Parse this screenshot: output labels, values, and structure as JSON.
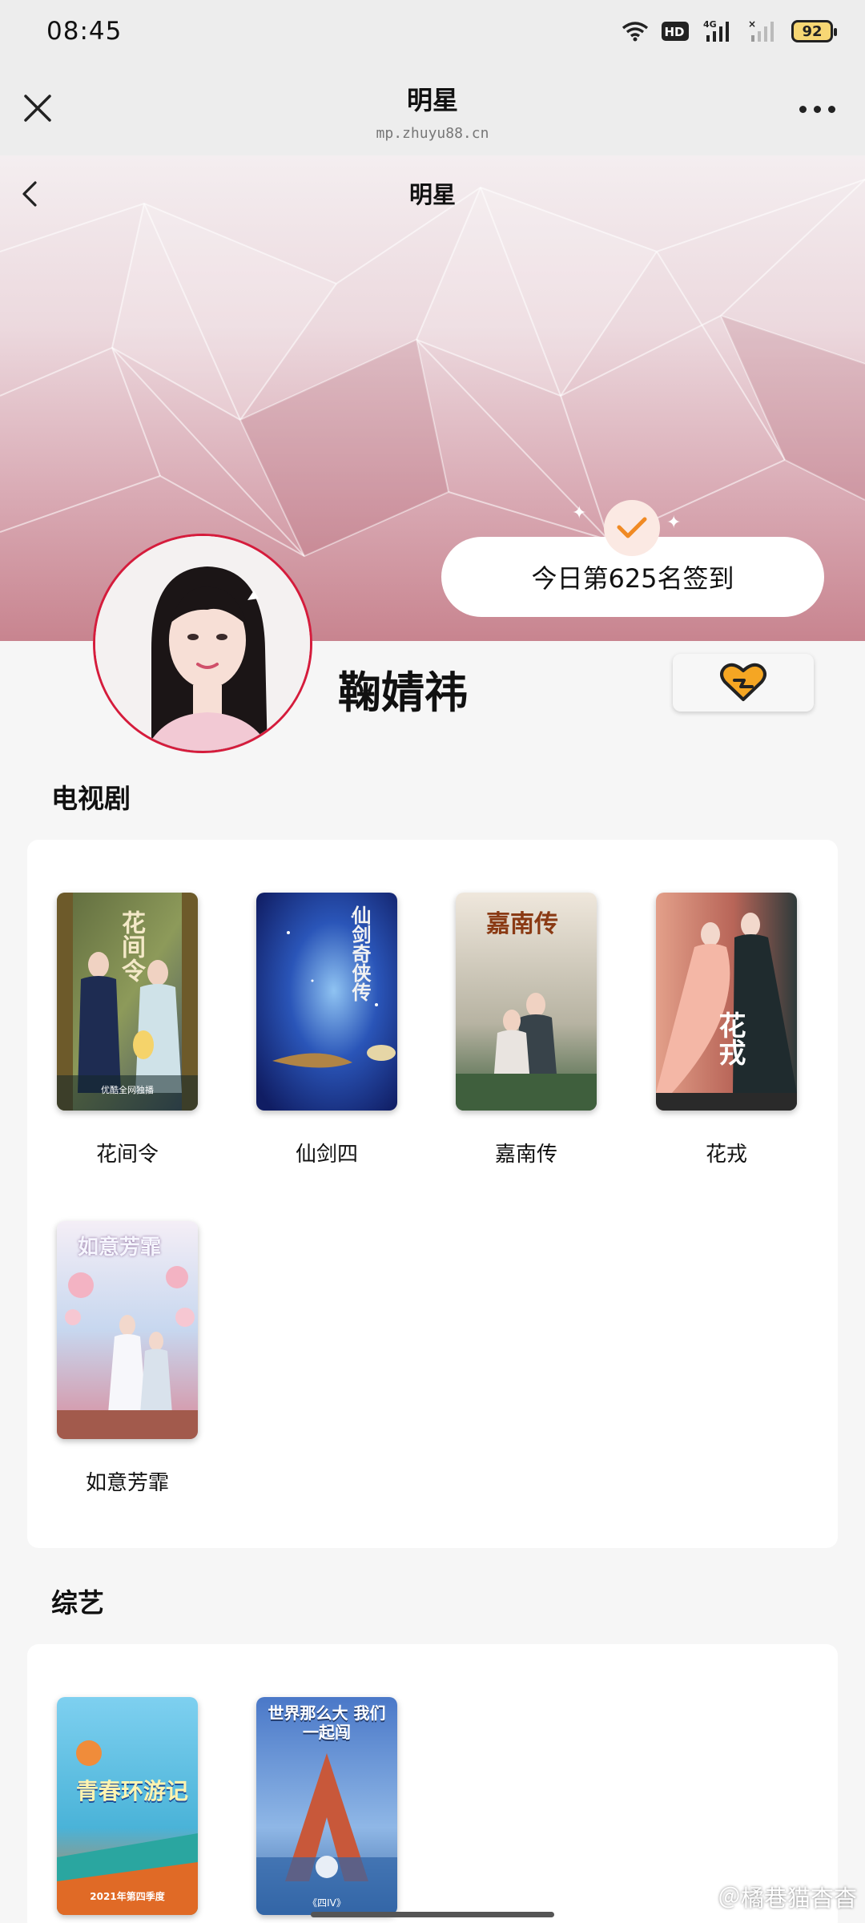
{
  "status_bar": {
    "time": "08:45",
    "hd_label": "HD",
    "network_label": "4G",
    "battery_level": "92"
  },
  "mp_header": {
    "title": "明星",
    "url": "mp.zhuyu88.cn",
    "close_icon": "close-icon",
    "more_icon": "more-icon"
  },
  "page": {
    "title": "明星",
    "back_icon": "chevron-left-icon"
  },
  "checkin": {
    "text": "今日第625名签到"
  },
  "profile": {
    "name": "鞠婧祎",
    "follow_icon": "heart-icon",
    "accent_color": "#f5a623"
  },
  "tv_section": {
    "title": "电视剧",
    "items": [
      {
        "label": "花间令",
        "poster_text": "花间令",
        "caption": "优酷全网独播"
      },
      {
        "label": "仙剑四",
        "poster_text": "仙剑奇侠传"
      },
      {
        "label": "嘉南传",
        "poster_text": "嘉南传"
      },
      {
        "label": "花戎",
        "poster_text": "花戎"
      },
      {
        "label": "如意芳霏",
        "poster_text": "如意芳霏"
      }
    ]
  },
  "variety_section": {
    "title": "综艺",
    "items": [
      {
        "label": "青春环游记",
        "poster_text": "青春环游记",
        "caption": "2021年第四季度"
      },
      {
        "label": "四IV",
        "poster_text": "世界那么大 我们一起闯",
        "caption": "《四IV》"
      }
    ]
  },
  "watermark": "＠橘巷猫杳杳"
}
